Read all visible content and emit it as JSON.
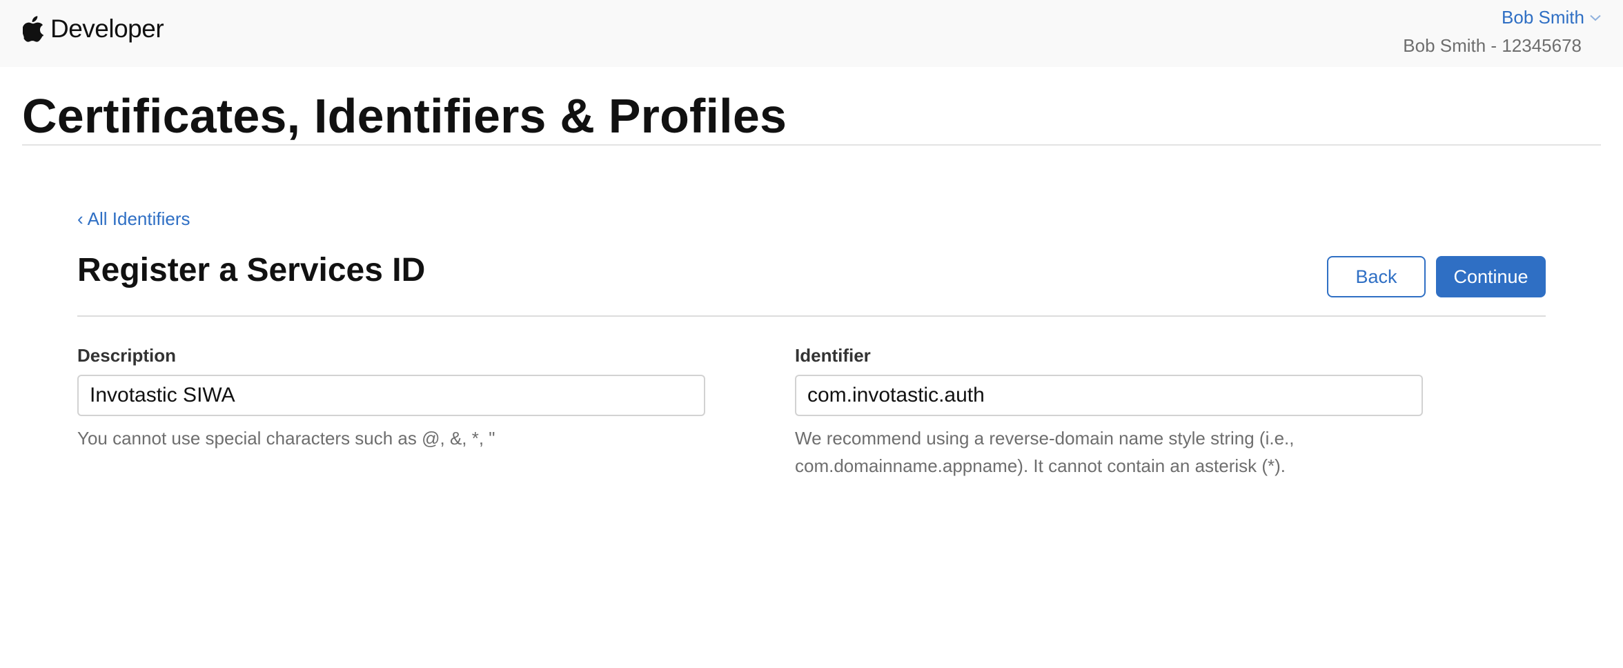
{
  "header": {
    "brand_icon": "apple-logo-icon",
    "brand_label": "Developer",
    "account_name": "Bob Smith",
    "account_menu_icon": "chevron-down-icon",
    "account_team": "Bob Smith - 12345678"
  },
  "page": {
    "title": "Certificates, Identifiers & Profiles"
  },
  "section": {
    "back_link_icon": "chevron-left-icon",
    "back_link_glyph": "‹",
    "back_link_label": "All Identifiers",
    "title": "Register a Services ID",
    "buttons": {
      "back_label": "Back",
      "continue_label": "Continue"
    }
  },
  "form": {
    "description": {
      "label": "Description",
      "value": "Invotastic SIWA",
      "hint": "You cannot use special characters such as @, &, *, \""
    },
    "identifier": {
      "label": "Identifier",
      "value": "com.invotastic.auth",
      "hint": "We recommend using a reverse-domain name style string (i.e., com.domainname.appname). It cannot contain an asterisk (*)."
    }
  },
  "colors": {
    "accent": "#2f6fc4",
    "header_bg": "#f9f9f9",
    "hint_text": "#6e6e6e",
    "input_border": "#d2d2d2"
  }
}
